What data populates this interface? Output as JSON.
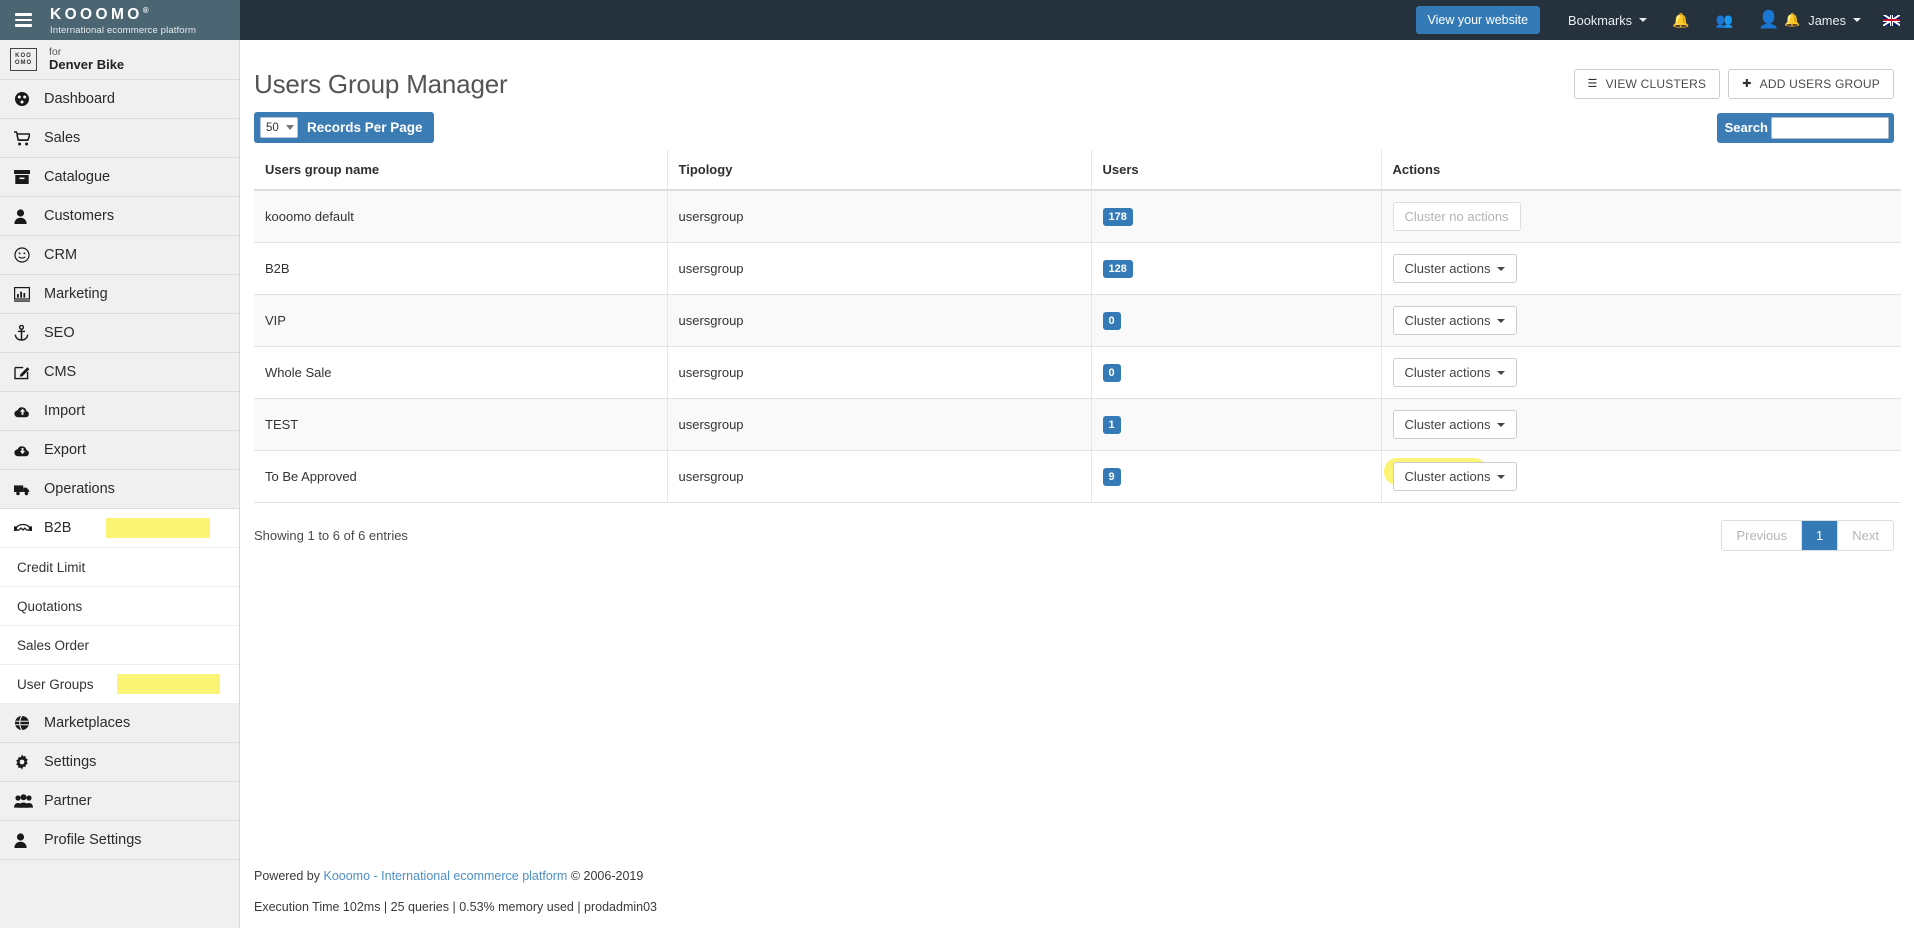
{
  "topbar": {
    "brand_name": "KOOOMO",
    "brand_reg": "®",
    "brand_tagline": "International ecommerce platform",
    "view_site_label": "View your website",
    "bookmarks_label": "Bookmarks",
    "user_name": "James",
    "icons": {
      "hamburger": "hamburger-icon",
      "bell": "bell-icon",
      "users": "users-group-icon",
      "avatar": "user-avatar-icon",
      "alert_bell": "red-bell-icon",
      "flag": "uk-flag-icon"
    },
    "accent_blue": "#337ab7",
    "bar_bg": "#25313c",
    "brand_bg": "#4b6573"
  },
  "sidebar": {
    "tenant_prefix": "for",
    "tenant_name": "Denver Bike",
    "tenant_logo_line1": "KOO",
    "tenant_logo_line2": "OMO",
    "items": [
      {
        "label": "Dashboard",
        "icon": "dashboard-icon",
        "glyph": "⚙"
      },
      {
        "label": "Sales",
        "icon": "cart-icon",
        "glyph": "🛒"
      },
      {
        "label": "Catalogue",
        "icon": "archive-box-icon",
        "glyph": "▤"
      },
      {
        "label": "Customers",
        "icon": "person-icon",
        "glyph": "👤"
      },
      {
        "label": "CRM",
        "icon": "smiley-icon",
        "glyph": "☺"
      },
      {
        "label": "Marketing",
        "icon": "bar-chart-icon",
        "glyph": "📊"
      },
      {
        "label": "SEO",
        "icon": "anchor-icon",
        "glyph": "⚓"
      },
      {
        "label": "CMS",
        "icon": "edit-pencil-icon",
        "glyph": "✎"
      },
      {
        "label": "Import",
        "icon": "cloud-upload-icon",
        "glyph": "☁"
      },
      {
        "label": "Export",
        "icon": "cloud-download-icon",
        "glyph": "☁"
      },
      {
        "label": "Operations",
        "icon": "truck-icon",
        "glyph": "🚚"
      }
    ],
    "b2b": {
      "label": "B2B",
      "icon": "handshake-icon",
      "glyph": "🤝",
      "highlighted": true,
      "children": [
        {
          "label": "Credit Limit",
          "highlighted": false
        },
        {
          "label": "Quotations",
          "highlighted": false
        },
        {
          "label": "Sales Order",
          "highlighted": false
        },
        {
          "label": "User Groups",
          "highlighted": true
        }
      ]
    },
    "items_bottom": [
      {
        "label": "Marketplaces",
        "icon": "globe-icon",
        "glyph": "🌐"
      },
      {
        "label": "Settings",
        "icon": "gear-icon",
        "glyph": "⚙"
      },
      {
        "label": "Partner",
        "icon": "people-icon",
        "glyph": "👥"
      },
      {
        "label": "Profile Settings",
        "icon": "person-icon",
        "glyph": "👤"
      }
    ],
    "highlight_color": "#fbf474"
  },
  "page": {
    "title": "Users Group Manager",
    "view_clusters_label": "VIEW CLUSTERS",
    "add_users_group_label": "ADD USERS GROUP",
    "view_clusters_icon": "list-icon",
    "add_icon": "plus-icon"
  },
  "controls": {
    "records_per_page_value": "50",
    "records_per_page_label": "Records Per Page",
    "search_label": "Search",
    "search_value": "",
    "search_placeholder": ""
  },
  "table": {
    "columns": [
      "Users group name",
      "Tipology",
      "Users",
      "Actions"
    ],
    "rows": [
      {
        "name": "kooomo default",
        "tipology": "usersgroup",
        "users": "178",
        "action": "Cluster no actions",
        "disabled": true,
        "highlighted": false
      },
      {
        "name": "B2B",
        "tipology": "usersgroup",
        "users": "128",
        "action": "Cluster actions",
        "disabled": false,
        "highlighted": false
      },
      {
        "name": "VIP",
        "tipology": "usersgroup",
        "users": "0",
        "action": "Cluster actions",
        "disabled": false,
        "highlighted": false
      },
      {
        "name": "Whole Sale",
        "tipology": "usersgroup",
        "users": "0",
        "action": "Cluster actions",
        "disabled": false,
        "highlighted": false
      },
      {
        "name": "TEST",
        "tipology": "usersgroup",
        "users": "1",
        "action": "Cluster actions",
        "disabled": false,
        "highlighted": false
      },
      {
        "name": "To Be Approved",
        "tipology": "usersgroup",
        "users": "9",
        "action": "Cluster actions",
        "disabled": false,
        "highlighted": true
      }
    ],
    "badge_color": "#337ab7"
  },
  "table_footer": {
    "entries_info": "Showing 1 to 6 of 6 entries",
    "previous_label": "Previous",
    "page_label": "1",
    "next_label": "Next"
  },
  "footer": {
    "powered_prefix": "Powered by ",
    "link_text": "Kooomo - International ecommerce platform",
    "copyright": " © 2006-2019",
    "stats": "Execution Time 102ms | 25 queries | 0.53% memory used | prodadmin03"
  }
}
